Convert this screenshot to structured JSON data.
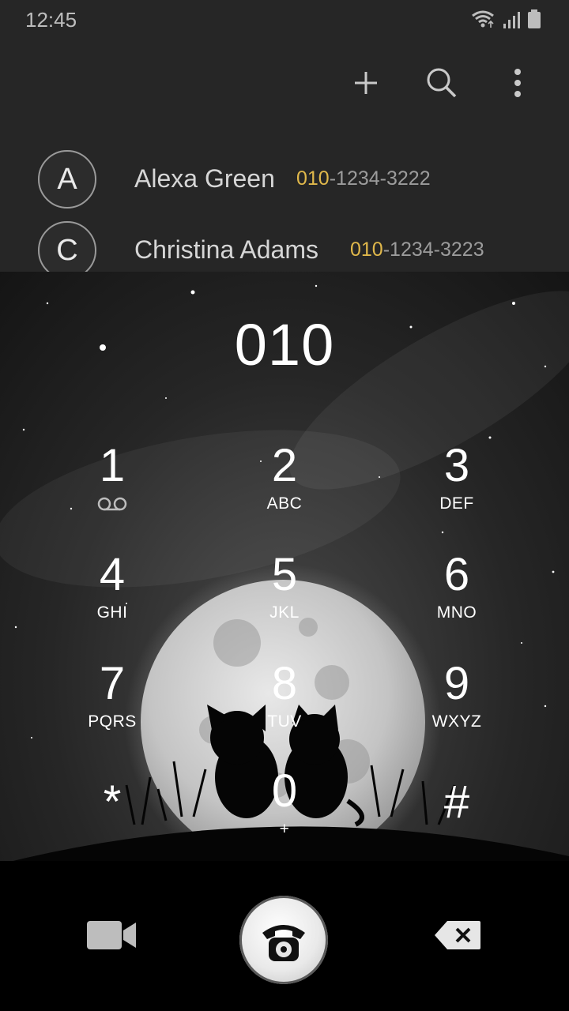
{
  "status_bar": {
    "time": "12:45"
  },
  "toolbar": {
    "add_icon": "plus-icon",
    "search_icon": "search-icon",
    "more_icon": "more-vertical-icon"
  },
  "contacts": [
    {
      "initial": "A",
      "name": "Alexa Green",
      "number_match": "010",
      "number_rest": "-1234-3222"
    },
    {
      "initial": "C",
      "name": "Christina Adams",
      "number_match": "010",
      "number_rest": "-1234-3223"
    }
  ],
  "dialer": {
    "entered_number": "010",
    "keys": [
      {
        "digit": "1",
        "letters": ""
      },
      {
        "digit": "2",
        "letters": "ABC"
      },
      {
        "digit": "3",
        "letters": "DEF"
      },
      {
        "digit": "4",
        "letters": "GHI"
      },
      {
        "digit": "5",
        "letters": "JKL"
      },
      {
        "digit": "6",
        "letters": "MNO"
      },
      {
        "digit": "7",
        "letters": "PQRS"
      },
      {
        "digit": "8",
        "letters": "TUV"
      },
      {
        "digit": "9",
        "letters": "WXYZ"
      },
      {
        "digit": "*",
        "letters": ""
      },
      {
        "digit": "0",
        "letters": "+"
      },
      {
        "digit": "#",
        "letters": ""
      }
    ]
  },
  "bottom": {
    "video_icon": "video-call-icon",
    "call_icon": "phone-call-icon",
    "delete_icon": "backspace-icon"
  },
  "colors": {
    "match_highlight": "#e0b84b",
    "background": "#262626"
  }
}
